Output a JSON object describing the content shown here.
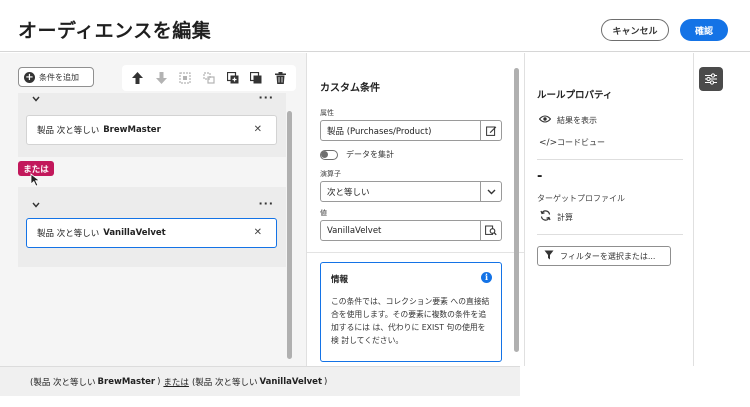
{
  "header": {
    "title": "オーディエンスを編集",
    "cancel_label": "キャンセル",
    "confirm_label": "確認"
  },
  "left": {
    "add_condition_label": "条件を追加",
    "toolbar_icons": [
      "arrow-up-icon",
      "arrow-down-icon",
      "group-icon",
      "ungroup-icon",
      "copy-icon",
      "paste-icon",
      "delete-icon"
    ],
    "groups": [
      {
        "condition": {
          "prefix": "製品 次と等しい",
          "value": "BrewMaster"
        }
      },
      {
        "condition": {
          "prefix": "製品 次と等しい",
          "value": "VanillaVelvet"
        }
      }
    ],
    "or_badge": "または",
    "accent_color": "#c2185b"
  },
  "footer": {
    "open": "(製品 次と等しい",
    "value1": "BrewMaster",
    "close1": ")",
    "operator": "または",
    "open2": "(製品 次と等しい",
    "value2": "VanillaVelvet",
    "close2": ")"
  },
  "middle": {
    "title": "カスタム条件",
    "attribute_label": "属性",
    "attribute_value": "製品 (Purchases/Product)",
    "aggregate_label": "データを集計",
    "operator_label": "演算子",
    "operator_value": "次と等しい",
    "value_label": "値",
    "value_value": "VanillaVelvet",
    "info_title": "情報",
    "info_body": "この条件では、コレクション要素 への直接結合を使用します。その要素に複数の条件を追加するには は、代わりに EXIST 句の使用を検 討してください。"
  },
  "right": {
    "title": "ルールプロパティ",
    "view_results": "結果を表示",
    "code_view": "コードビュー",
    "count": "-",
    "target_profile": "ターゲットプロファイル",
    "calculate": "計算",
    "filter_button": "フィルターを選択または..."
  },
  "colors": {
    "primary": "#1473e6",
    "or_badge": "#c2185b"
  }
}
